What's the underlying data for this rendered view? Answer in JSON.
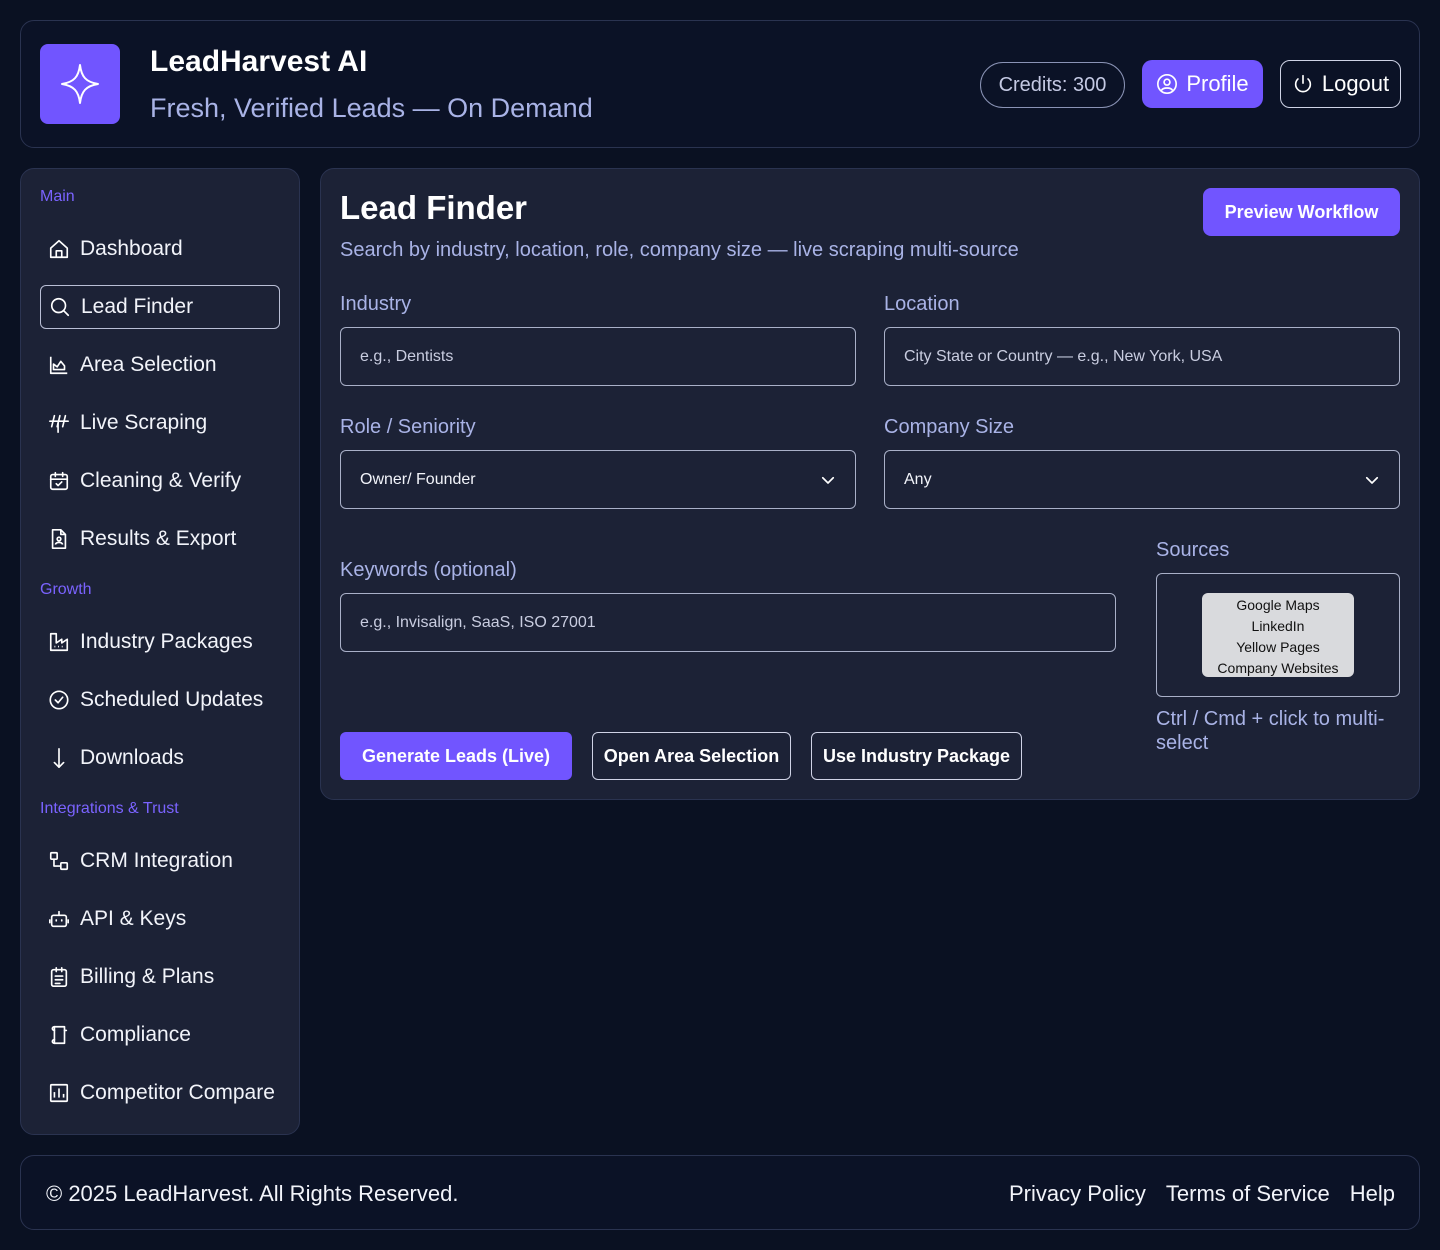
{
  "header": {
    "title": "LeadHarvest AI",
    "subtitle": "Fresh, Verified Leads — On Demand",
    "credits_label": "Credits: 300",
    "profile_label": "Profile",
    "logout_label": "Logout",
    "accent": "#7155ff"
  },
  "sidebar": {
    "sections": [
      "Main",
      "Growth",
      "Integrations & Trust"
    ],
    "items": [
      {
        "label": "Dashboard",
        "icon": "home-icon"
      },
      {
        "label": "Lead Finder",
        "icon": "search-icon"
      },
      {
        "label": "Area Selection",
        "icon": "chart-area-icon"
      },
      {
        "label": "Live Scraping",
        "icon": "antenna-icon"
      },
      {
        "label": "Cleaning & Verify",
        "icon": "calendar-check-icon"
      },
      {
        "label": "Results & Export",
        "icon": "file-user-icon"
      },
      {
        "label": "Industry Packages",
        "icon": "building-icon"
      },
      {
        "label": "Scheduled Updates",
        "icon": "check-circle-icon"
      },
      {
        "label": "Downloads",
        "icon": "arrow-down-icon"
      },
      {
        "label": "CRM Integration",
        "icon": "share-nodes-icon"
      },
      {
        "label": "API & Keys",
        "icon": "robot-icon"
      },
      {
        "label": "Billing & Plans",
        "icon": "receipt-icon"
      },
      {
        "label": "Compliance",
        "icon": "scroll-icon"
      },
      {
        "label": "Competitor Compare",
        "icon": "bar-chart-icon"
      }
    ],
    "active": "Lead Finder"
  },
  "main": {
    "title": "Lead Finder",
    "subtitle": "Search by industry, location, role, company size — live scraping multi-source",
    "preview_label": "Preview Workflow",
    "industry": {
      "label": "Industry",
      "placeholder": "e.g., Dentists"
    },
    "location": {
      "label": "Location",
      "placeholder": "City State or Country — e.g., New York, USA"
    },
    "role": {
      "label": "Role / Seniority",
      "value": "Owner/ Founder"
    },
    "company_size": {
      "label": "Company Size",
      "value": "Any"
    },
    "keywords": {
      "label": "Keywords (optional)",
      "placeholder": "e.g., Invisalign, SaaS, ISO 27001"
    },
    "sources": {
      "label": "Sources",
      "options": [
        "Google Maps",
        "LinkedIn",
        "Yellow Pages",
        "Company Websites"
      ],
      "hint": "Ctrl / Cmd + click to multi-select"
    },
    "actions": {
      "generate": "Generate Leads (Live)",
      "area": "Open Area Selection",
      "package": "Use Industry Package"
    }
  },
  "footer": {
    "copyright": "© 2025 LeadHarvest. All Rights Reserved.",
    "links": [
      "Privacy Policy",
      "Terms of Service",
      "Help"
    ]
  }
}
